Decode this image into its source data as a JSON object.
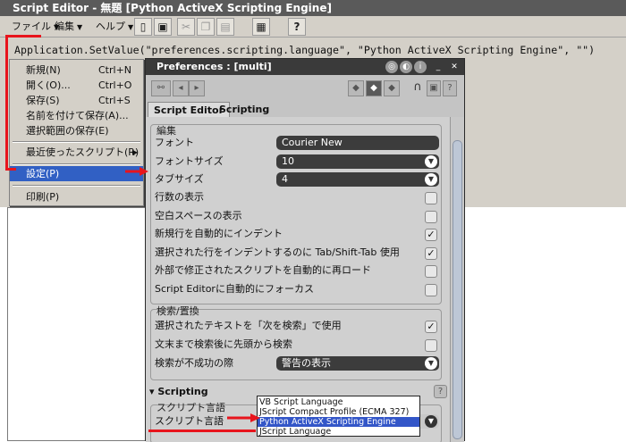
{
  "window": {
    "title": "Script Editor - 無題 [Python ActiveX Scripting Engine]"
  },
  "menubar": {
    "items": [
      {
        "label": "ファイル"
      },
      {
        "label": "編集"
      },
      {
        "label": "ヘルプ"
      }
    ]
  },
  "toolbar": {
    "buttons": [
      "cut-icon",
      "copy-icon",
      "paste-icon",
      "new-icon",
      "save-icon",
      "run-icon",
      "help-icon"
    ],
    "help_label": "?"
  },
  "editor": {
    "code": "Application.SetValue(\"preferences.scripting.language\", \"Python ActiveX Scripting Engine\", \"\")"
  },
  "file_menu": {
    "items": [
      {
        "label": "新規(N)",
        "shortcut": "Ctrl+N"
      },
      {
        "label": "開く(O)...",
        "shortcut": "Ctrl+O"
      },
      {
        "label": "保存(S)",
        "shortcut": "Ctrl+S"
      },
      {
        "label": "名前を付けて保存(A)...",
        "shortcut": ""
      },
      {
        "label": "選択範囲の保存(E)",
        "shortcut": ""
      },
      {
        "label": "最近使ったスクリプト(R)",
        "shortcut": ""
      },
      {
        "label": "設定(P)",
        "shortcut": ""
      },
      {
        "label": "印刷(P)",
        "shortcut": ""
      }
    ],
    "submenu_arrow": "▶"
  },
  "preferences": {
    "title": "Preferences : [multi]",
    "tabs": [
      {
        "label": "Script Editor"
      },
      {
        "label": "Scripting"
      }
    ],
    "edit_section": {
      "label": "編集",
      "font": {
        "label": "フォント",
        "value": "Courier New"
      },
      "font_size": {
        "label": "フォントサイズ",
        "value": "10"
      },
      "tab_size": {
        "label": "タブサイズ",
        "value": "4"
      },
      "checks": [
        {
          "label": "行数の表示",
          "checked": false
        },
        {
          "label": "空白スペースの表示",
          "checked": false
        },
        {
          "label": "新規行を自動的にインデント",
          "checked": true
        },
        {
          "label": "選択された行をインデントするのに Tab/Shift-Tab 使用",
          "checked": true
        },
        {
          "label": "外部で修正されたスクリプトを自動的に再ロード",
          "checked": false
        },
        {
          "label": "Script Editorに自動的にフォーカス",
          "checked": false
        }
      ]
    },
    "search_section": {
      "label": "検索/置換",
      "checks": [
        {
          "label": "選択されたテキストを「次を検索」で使用",
          "checked": true
        },
        {
          "label": "文末まで検索後に先頭から検索",
          "checked": false
        }
      ],
      "on_fail": {
        "label": "検索が不成功の際",
        "value": "警告の表示"
      }
    },
    "scripting_section": {
      "header": "Scripting",
      "group_label": "スクリプト言語",
      "language_label": "スクリプト言語",
      "help_label": "?",
      "language_options": [
        "VB Script Language",
        "JScript Compact Profile (ECMA 327)",
        "Python ActiveX Scripting Engine",
        "JScript Language"
      ],
      "selected_index": 2
    }
  },
  "colors": {
    "menu_highlight": "#3160c4",
    "annotation": "#e8141c"
  }
}
